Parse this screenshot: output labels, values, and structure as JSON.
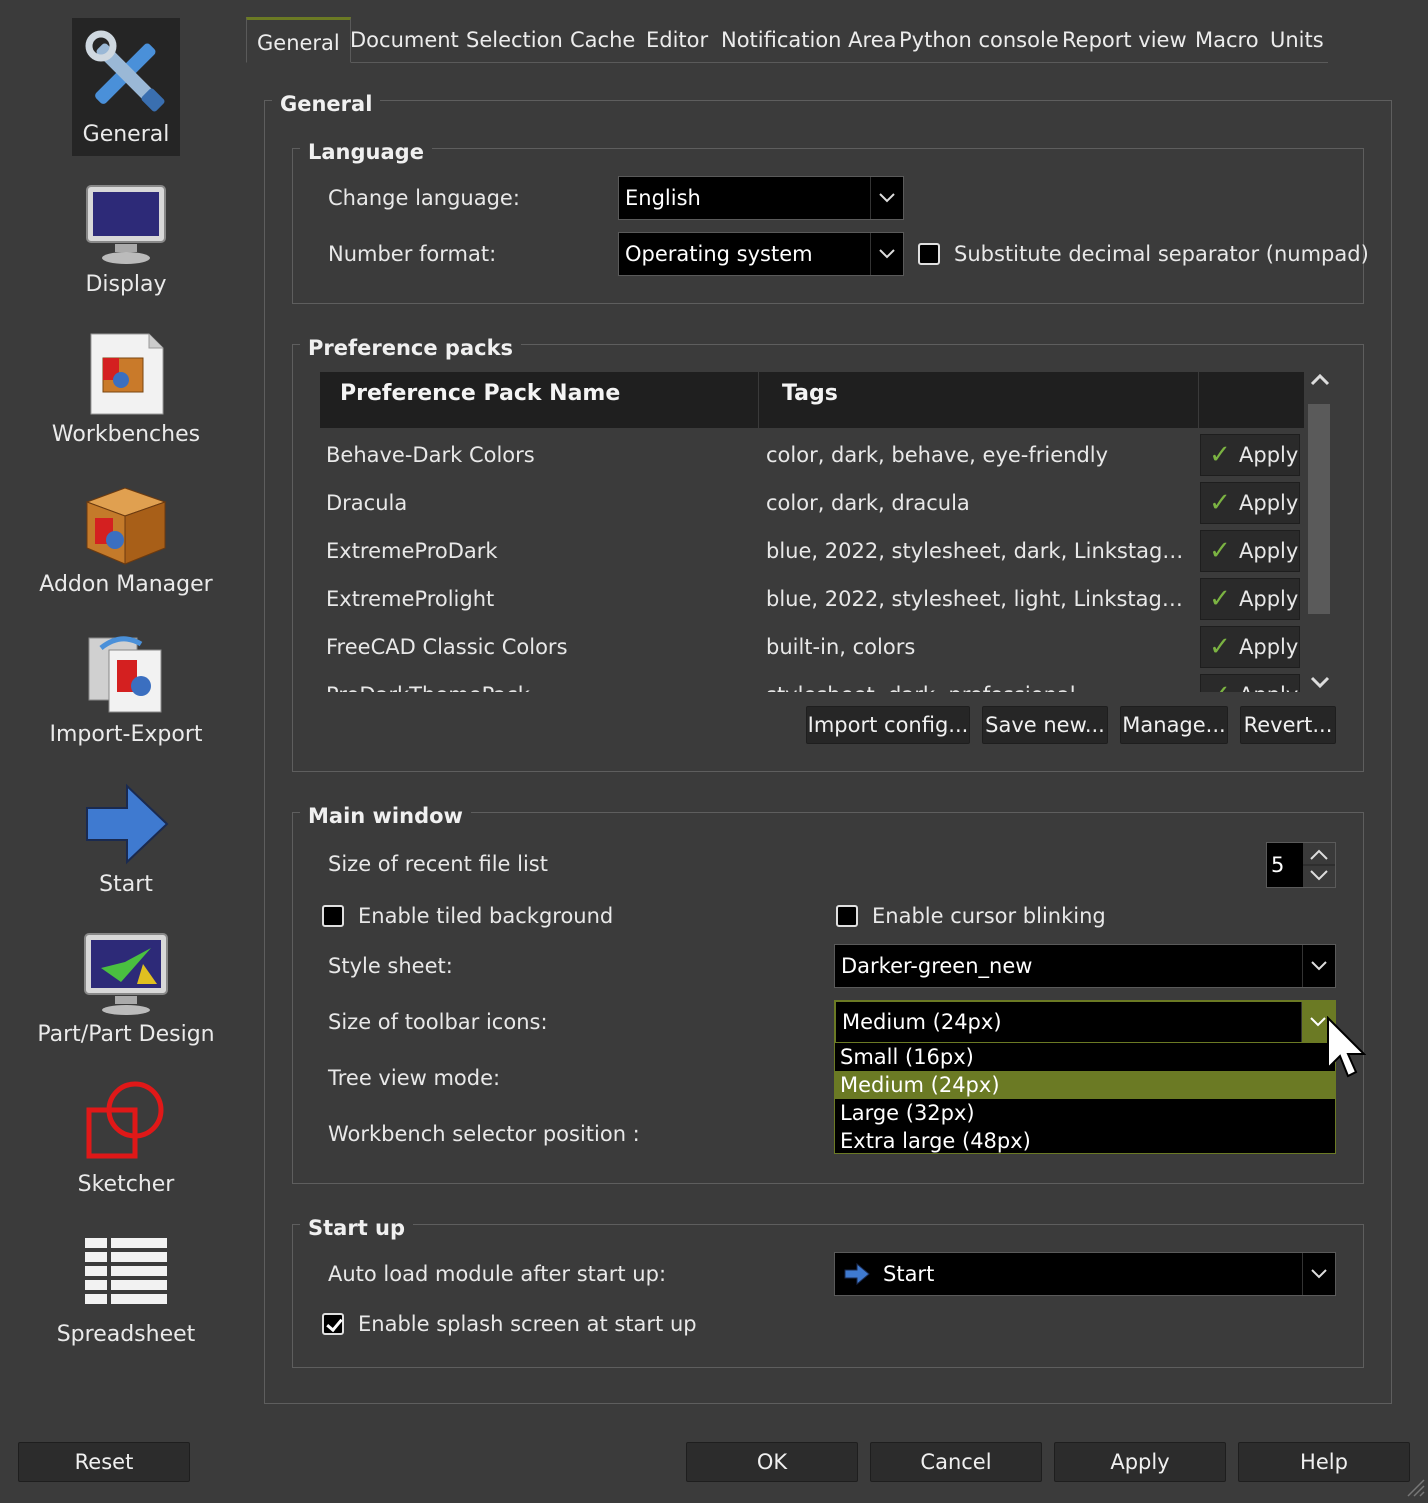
{
  "sidebar": {
    "items": [
      {
        "label": "General",
        "icon": "tools-icon"
      },
      {
        "label": "Display",
        "icon": "monitor-icon"
      },
      {
        "label": "Workbenches",
        "icon": "workbench-box-icon"
      },
      {
        "label": "Addon Manager",
        "icon": "addon-box-icon"
      },
      {
        "label": "Import-Export",
        "icon": "import-export-icon"
      },
      {
        "label": "Start",
        "icon": "arrow-right-icon"
      },
      {
        "label": "Part/Part Design",
        "icon": "part-design-icon"
      },
      {
        "label": "Sketcher",
        "icon": "sketcher-icon"
      },
      {
        "label": "Spreadsheet",
        "icon": "spreadsheet-icon"
      }
    ]
  },
  "tabs": [
    "General",
    "Document",
    "Selection",
    "Cache",
    "Editor",
    "Notification Area",
    "Python console",
    "Report view",
    "Macro",
    "Units"
  ],
  "general_group": {
    "title": "General"
  },
  "language": {
    "title": "Language",
    "change_language_label": "Change language:",
    "change_language_value": "English",
    "number_format_label": "Number format:",
    "number_format_value": "Operating system",
    "substitute_label": "Substitute decimal separator (numpad)",
    "substitute_checked": false
  },
  "packs": {
    "title": "Preference packs",
    "col_name": "Preference Pack Name",
    "col_tags": "Tags",
    "rows": [
      {
        "name": "Behave-Dark Colors",
        "tags": "color, dark, behave, eye-friendly",
        "action": "Apply"
      },
      {
        "name": "Dracula",
        "tags": "color, dark, dracula",
        "action": "Apply"
      },
      {
        "name": "ExtremeProDark",
        "tags": "blue, 2022, stylesheet, dark, Linkstage, ...",
        "action": "Apply"
      },
      {
        "name": "ExtremeProlight",
        "tags": "blue, 2022, stylesheet, light, Linkstage,...",
        "action": "Apply"
      },
      {
        "name": "FreeCAD Classic Colors",
        "tags": "built-in, colors",
        "action": "Apply"
      },
      {
        "name": "ProDarkThemePack",
        "tags": "stylesheet, dark, professional",
        "action": "Apply"
      }
    ],
    "buttons": {
      "import": "Import config...",
      "save": "Save new...",
      "manage": "Manage...",
      "revert": "Revert..."
    }
  },
  "main_window": {
    "title": "Main window",
    "recent_label": "Size of recent file list",
    "recent_value": "5",
    "tiled_label": "Enable tiled background",
    "tiled_checked": false,
    "blink_label": "Enable cursor blinking",
    "blink_checked": false,
    "stylesheet_label": "Style sheet:",
    "stylesheet_value": "Darker-green_new",
    "toolbar_label": "Size of toolbar icons:",
    "toolbar_value": "Medium (24px)",
    "toolbar_options": [
      "Small (16px)",
      "Medium (24px)",
      "Large (32px)",
      "Extra large (48px)"
    ],
    "toolbar_highlighted": "Medium (24px)",
    "treeview_label": "Tree view mode:",
    "wb_selector_label": "Workbench selector position :"
  },
  "startup": {
    "title": "Start up",
    "autoload_label": "Auto load module after start up:",
    "autoload_value": "Start",
    "splash_label": "Enable splash screen at start up",
    "splash_checked": true
  },
  "footer": {
    "reset": "Reset",
    "ok": "OK",
    "cancel": "Cancel",
    "apply": "Apply",
    "help": "Help"
  },
  "colors": {
    "accent": "#6b7a24",
    "background": "#3b3b3b",
    "field": "#000000"
  }
}
